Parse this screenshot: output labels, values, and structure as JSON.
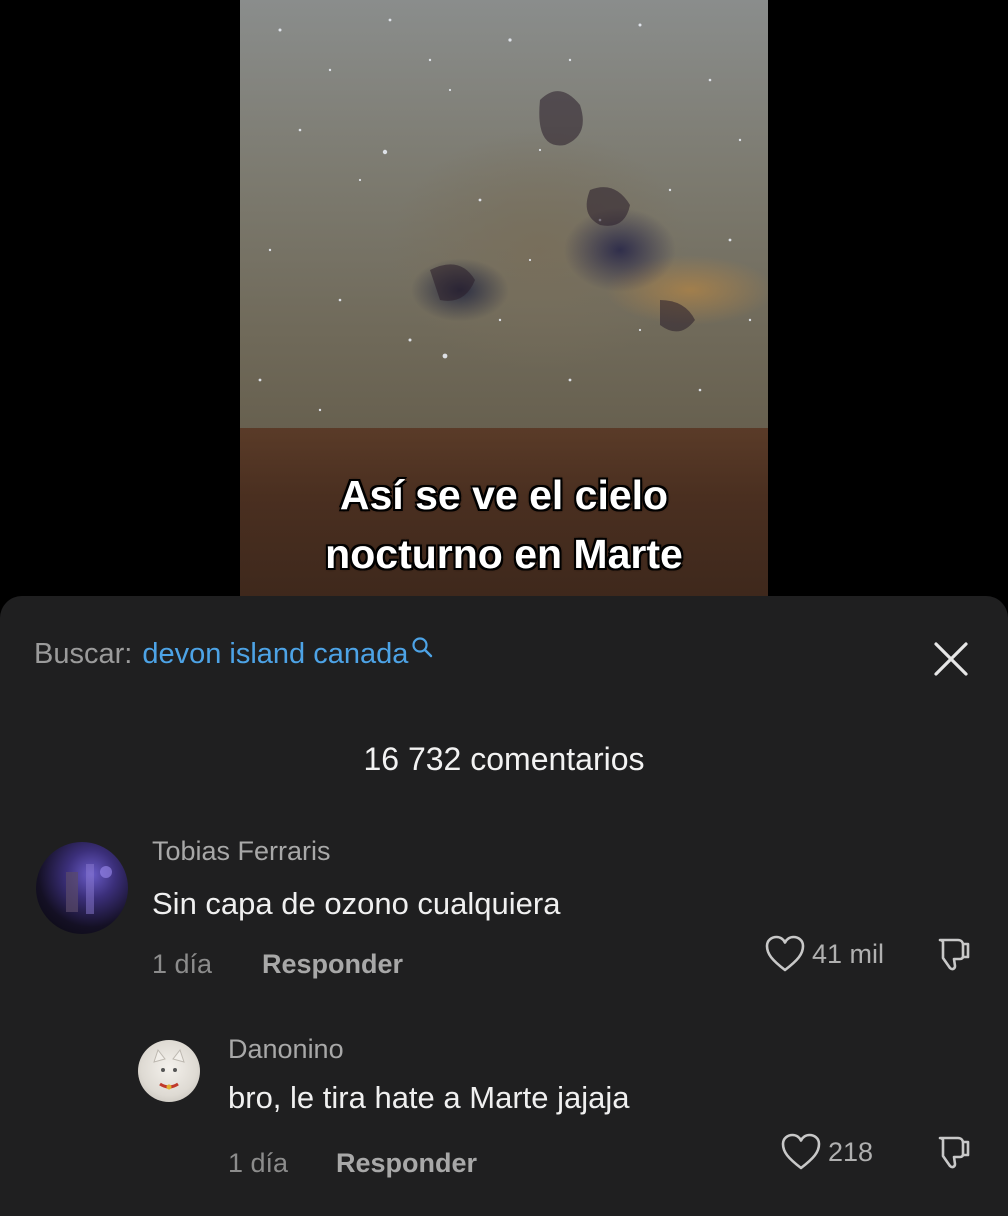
{
  "video": {
    "caption_line1": "Así se ve el cielo",
    "caption_line2": "nocturno en Marte"
  },
  "search": {
    "label": "Buscar:",
    "query": "devon island canada",
    "icon": "search-icon",
    "accent_color": "#4da3e6"
  },
  "close_icon": "close-icon",
  "comments_count": "16 732 comentarios",
  "comments": [
    {
      "author": "Tobias Ferraris",
      "text": "Sin capa de ozono cualquiera",
      "time": "1 día",
      "reply_label": "Responder",
      "likes": "41 mil"
    },
    {
      "author": "Danonino",
      "text": "bro, le tira hate a Marte jajaja",
      "time": "1 día",
      "reply_label": "Responder",
      "likes": "218"
    }
  ]
}
